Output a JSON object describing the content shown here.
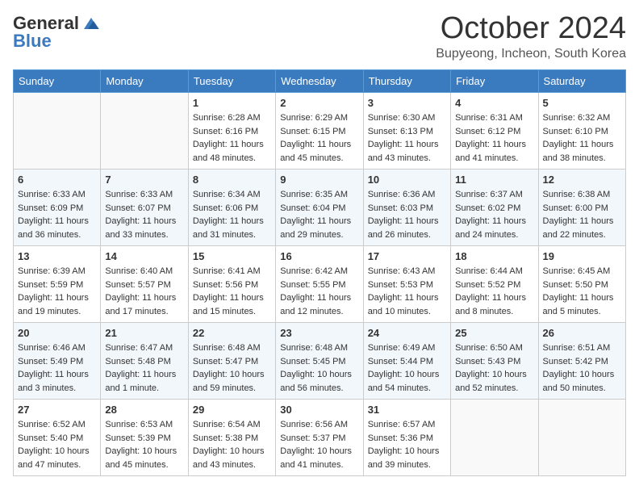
{
  "header": {
    "logo_line1": "General",
    "logo_line2": "Blue",
    "month_title": "October 2024",
    "location": "Bupyeong, Incheon, South Korea"
  },
  "days_of_week": [
    "Sunday",
    "Monday",
    "Tuesday",
    "Wednesday",
    "Thursday",
    "Friday",
    "Saturday"
  ],
  "weeks": [
    [
      {
        "day": "",
        "info": ""
      },
      {
        "day": "",
        "info": ""
      },
      {
        "day": "1",
        "sunrise": "6:28 AM",
        "sunset": "6:16 PM",
        "daylight": "11 hours and 48 minutes."
      },
      {
        "day": "2",
        "sunrise": "6:29 AM",
        "sunset": "6:15 PM",
        "daylight": "11 hours and 45 minutes."
      },
      {
        "day": "3",
        "sunrise": "6:30 AM",
        "sunset": "6:13 PM",
        "daylight": "11 hours and 43 minutes."
      },
      {
        "day": "4",
        "sunrise": "6:31 AM",
        "sunset": "6:12 PM",
        "daylight": "11 hours and 41 minutes."
      },
      {
        "day": "5",
        "sunrise": "6:32 AM",
        "sunset": "6:10 PM",
        "daylight": "11 hours and 38 minutes."
      }
    ],
    [
      {
        "day": "6",
        "sunrise": "6:33 AM",
        "sunset": "6:09 PM",
        "daylight": "11 hours and 36 minutes."
      },
      {
        "day": "7",
        "sunrise": "6:33 AM",
        "sunset": "6:07 PM",
        "daylight": "11 hours and 33 minutes."
      },
      {
        "day": "8",
        "sunrise": "6:34 AM",
        "sunset": "6:06 PM",
        "daylight": "11 hours and 31 minutes."
      },
      {
        "day": "9",
        "sunrise": "6:35 AM",
        "sunset": "6:04 PM",
        "daylight": "11 hours and 29 minutes."
      },
      {
        "day": "10",
        "sunrise": "6:36 AM",
        "sunset": "6:03 PM",
        "daylight": "11 hours and 26 minutes."
      },
      {
        "day": "11",
        "sunrise": "6:37 AM",
        "sunset": "6:02 PM",
        "daylight": "11 hours and 24 minutes."
      },
      {
        "day": "12",
        "sunrise": "6:38 AM",
        "sunset": "6:00 PM",
        "daylight": "11 hours and 22 minutes."
      }
    ],
    [
      {
        "day": "13",
        "sunrise": "6:39 AM",
        "sunset": "5:59 PM",
        "daylight": "11 hours and 19 minutes."
      },
      {
        "day": "14",
        "sunrise": "6:40 AM",
        "sunset": "5:57 PM",
        "daylight": "11 hours and 17 minutes."
      },
      {
        "day": "15",
        "sunrise": "6:41 AM",
        "sunset": "5:56 PM",
        "daylight": "11 hours and 15 minutes."
      },
      {
        "day": "16",
        "sunrise": "6:42 AM",
        "sunset": "5:55 PM",
        "daylight": "11 hours and 12 minutes."
      },
      {
        "day": "17",
        "sunrise": "6:43 AM",
        "sunset": "5:53 PM",
        "daylight": "11 hours and 10 minutes."
      },
      {
        "day": "18",
        "sunrise": "6:44 AM",
        "sunset": "5:52 PM",
        "daylight": "11 hours and 8 minutes."
      },
      {
        "day": "19",
        "sunrise": "6:45 AM",
        "sunset": "5:50 PM",
        "daylight": "11 hours and 5 minutes."
      }
    ],
    [
      {
        "day": "20",
        "sunrise": "6:46 AM",
        "sunset": "5:49 PM",
        "daylight": "11 hours and 3 minutes."
      },
      {
        "day": "21",
        "sunrise": "6:47 AM",
        "sunset": "5:48 PM",
        "daylight": "11 hours and 1 minute."
      },
      {
        "day": "22",
        "sunrise": "6:48 AM",
        "sunset": "5:47 PM",
        "daylight": "10 hours and 59 minutes."
      },
      {
        "day": "23",
        "sunrise": "6:48 AM",
        "sunset": "5:45 PM",
        "daylight": "10 hours and 56 minutes."
      },
      {
        "day": "24",
        "sunrise": "6:49 AM",
        "sunset": "5:44 PM",
        "daylight": "10 hours and 54 minutes."
      },
      {
        "day": "25",
        "sunrise": "6:50 AM",
        "sunset": "5:43 PM",
        "daylight": "10 hours and 52 minutes."
      },
      {
        "day": "26",
        "sunrise": "6:51 AM",
        "sunset": "5:42 PM",
        "daylight": "10 hours and 50 minutes."
      }
    ],
    [
      {
        "day": "27",
        "sunrise": "6:52 AM",
        "sunset": "5:40 PM",
        "daylight": "10 hours and 47 minutes."
      },
      {
        "day": "28",
        "sunrise": "6:53 AM",
        "sunset": "5:39 PM",
        "daylight": "10 hours and 45 minutes."
      },
      {
        "day": "29",
        "sunrise": "6:54 AM",
        "sunset": "5:38 PM",
        "daylight": "10 hours and 43 minutes."
      },
      {
        "day": "30",
        "sunrise": "6:56 AM",
        "sunset": "5:37 PM",
        "daylight": "10 hours and 41 minutes."
      },
      {
        "day": "31",
        "sunrise": "6:57 AM",
        "sunset": "5:36 PM",
        "daylight": "10 hours and 39 minutes."
      },
      {
        "day": "",
        "info": ""
      },
      {
        "day": "",
        "info": ""
      }
    ]
  ],
  "labels": {
    "sunrise": "Sunrise:",
    "sunset": "Sunset:",
    "daylight": "Daylight:"
  }
}
